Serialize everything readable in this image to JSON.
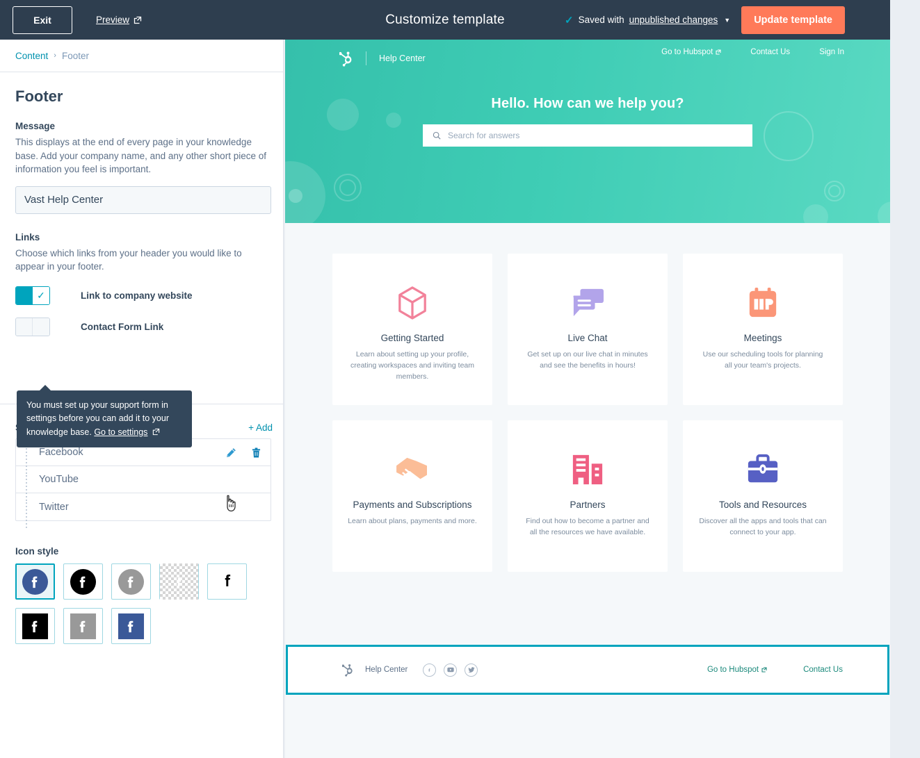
{
  "topbar": {
    "exit_label": "Exit",
    "preview_label": "Preview",
    "title": "Customize template",
    "saved_prefix": "Saved with",
    "saved_link": "unpublished changes",
    "update_label": "Update template",
    "accent_orange": "#ff7a59",
    "bg": "#2e3e4f"
  },
  "breadcrumb": {
    "parent": "Content",
    "separator": "›",
    "current": "Footer"
  },
  "panel": {
    "title": "Footer",
    "message_label": "Message",
    "message_help": "This displays at the end of every page in your knowledge base. Add your company name, and any other short piece of information you feel is important.",
    "message_value": "Vast Help Center",
    "message_placeholder": "Vast Help Center",
    "links_label": "Links",
    "links_help": "Choose which links from your header you would like to appear in your footer.",
    "toggles": [
      {
        "label": "Link to company website",
        "state": "on"
      },
      {
        "label": "Contact Form Link",
        "state": "off"
      }
    ],
    "tooltip": {
      "text": "You must set up your support form in settings before you can add it to your knowledge base.",
      "link": "Go to settings"
    },
    "social_title": "Social network",
    "social_add": "+ Add",
    "social_items": [
      {
        "name": "Facebook",
        "has_actions": true
      },
      {
        "name": "YouTube",
        "has_actions": false
      },
      {
        "name": "Twitter",
        "has_actions": false
      }
    ],
    "icon_style_title": "Icon style",
    "icon_styles": [
      {
        "id": "blue-circle",
        "shape": "circle",
        "bg": "#3b5998",
        "fg": "#ffffff",
        "selected": true
      },
      {
        "id": "black-circle",
        "shape": "circle",
        "bg": "#000000",
        "fg": "#ffffff",
        "selected": false
      },
      {
        "id": "gray-circle",
        "shape": "circle",
        "bg": "#999999",
        "fg": "#ffffff",
        "selected": false
      },
      {
        "id": "transparent-white",
        "shape": "checker",
        "bg": "transparent",
        "fg": "#ffffff",
        "selected": false
      },
      {
        "id": "plain-black-glyph",
        "shape": "plain",
        "bg": "#ffffff",
        "fg": "#000000",
        "selected": false
      },
      {
        "id": "black-square",
        "shape": "square",
        "bg": "#000000",
        "fg": "#ffffff",
        "selected": false
      },
      {
        "id": "gray-square",
        "shape": "square",
        "bg": "#999999",
        "fg": "#ffffff",
        "selected": false
      },
      {
        "id": "blue-square",
        "shape": "square",
        "bg": "#3b5998",
        "fg": "#ffffff",
        "selected": false
      }
    ]
  },
  "preview": {
    "hero": {
      "brand": "Help Center",
      "nav": [
        "Go to Hubspot",
        "Contact Us",
        "Sign In"
      ],
      "title": "Hello. How can we help you?",
      "search_placeholder": "Search for answers",
      "bg_color": "#3fcdb5"
    },
    "cards": [
      {
        "title": "Getting Started",
        "desc": "Learn about setting up your profile, creating workspaces and inviting team members.",
        "icon": "cube-icon",
        "color": "#f2829a"
      },
      {
        "title": "Live Chat",
        "desc": "Get set up on our live chat in minutes and see the benefits in hours!",
        "icon": "chat-bubbles-icon",
        "color": "#b2a4ea"
      },
      {
        "title": "Meetings",
        "desc": "Use our scheduling tools for planning all your team's projects.",
        "icon": "calendar-icon",
        "color": "#fb9678"
      },
      {
        "title": "Payments and Subscriptions",
        "desc": "Learn about plans, payments and more.",
        "icon": "handshake-icon",
        "color": "#fbbd97"
      },
      {
        "title": "Partners",
        "desc": "Find out how to become a partner and all the resources we have available.",
        "icon": "buildings-icon",
        "color": "#ef5f82"
      },
      {
        "title": "Tools and Resources",
        "desc": "Discover all the apps and tools that can connect to your app.",
        "icon": "toolbox-icon",
        "color": "#5760c4"
      }
    ],
    "footer": {
      "brand": "Help Center",
      "socials": [
        "facebook-icon",
        "youtube-icon",
        "twitter-icon"
      ],
      "links": [
        "Go to Hubspot",
        "Contact Us"
      ],
      "highlight_color": "#00a4bd"
    }
  }
}
